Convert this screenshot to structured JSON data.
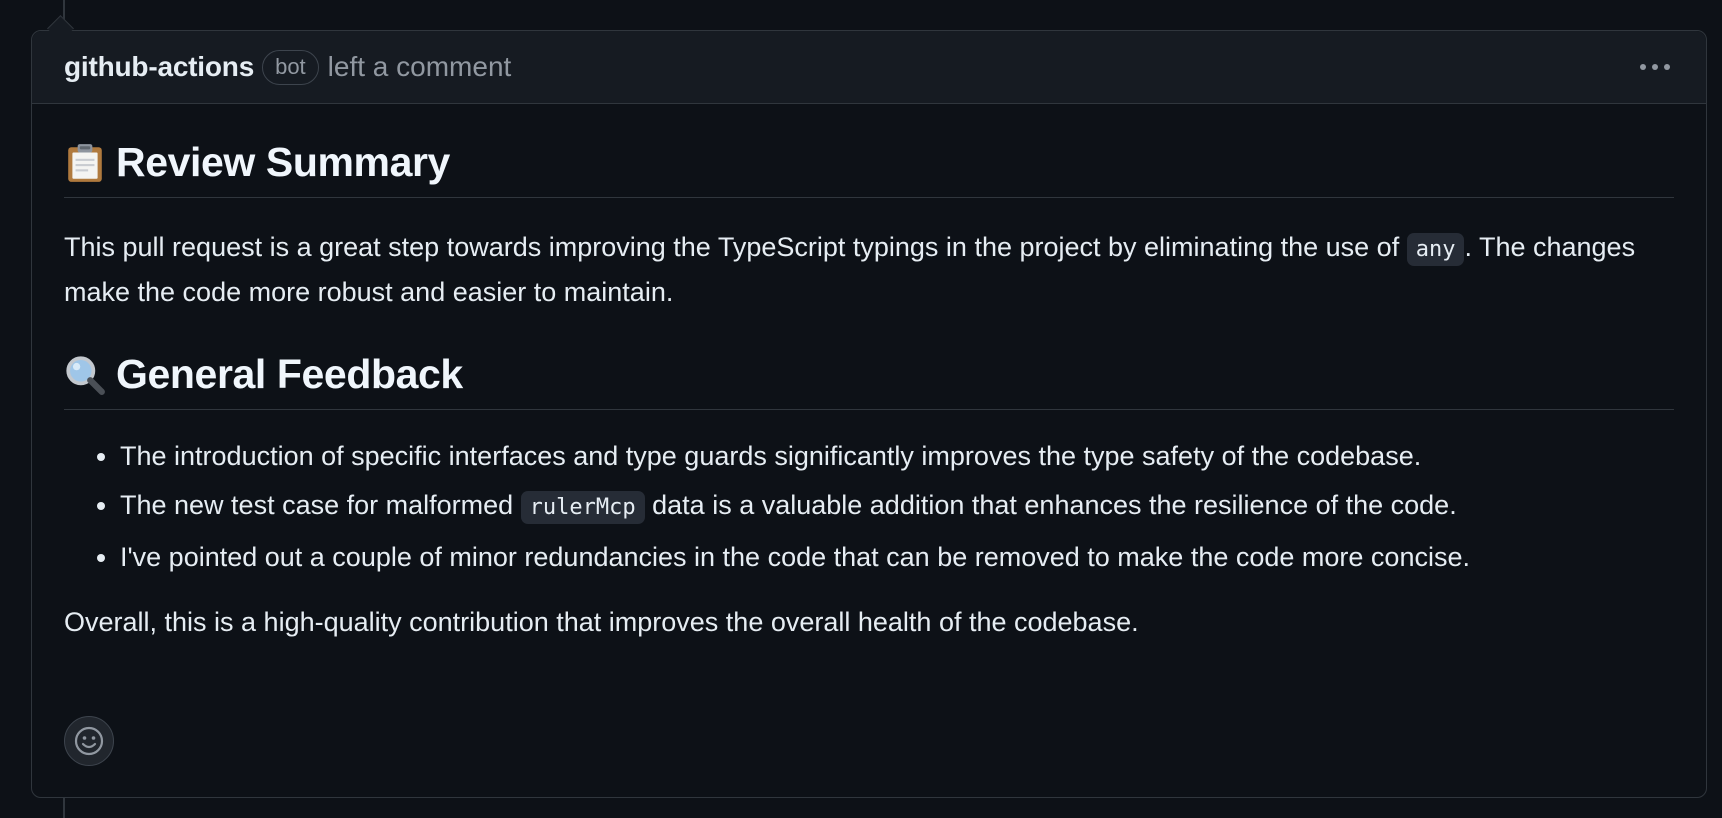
{
  "comment": {
    "author": "github-actions",
    "badge": "bot",
    "action": "left a comment",
    "menu_icon": "kebab-horizontal-icon",
    "reaction_icon": "smiley-icon"
  },
  "body": {
    "summary_heading": {
      "icon": "clipboard-icon",
      "text": "Review Summary"
    },
    "intro": {
      "before_code": "This pull request is a great step towards improving the TypeScript typings in the project by eliminating the use of ",
      "code": "any",
      "after_code": ". The changes make the code more robust and easier to maintain."
    },
    "feedback_heading": {
      "icon": "magnifying-glass-icon",
      "text": "General Feedback"
    },
    "feedback_items": [
      {
        "text": "The introduction of specific interfaces and type guards significantly improves the type safety of the codebase."
      },
      {
        "before_code": "The new test case for malformed ",
        "code": "rulerMcp",
        "after_code": " data is a valuable addition that enhances the resilience of the code."
      },
      {
        "text": "I've pointed out a couple of minor redundancies in the code that can be removed to make the code more concise."
      }
    ],
    "overall": "Overall, this is a high-quality contribution that improves the overall health of the codebase."
  },
  "colors": {
    "background": "#0d1117",
    "header_background": "#161b22",
    "border": "#30363d",
    "text": "#e6edf3",
    "muted_text": "#9198a1",
    "code_background": "#262c36"
  }
}
